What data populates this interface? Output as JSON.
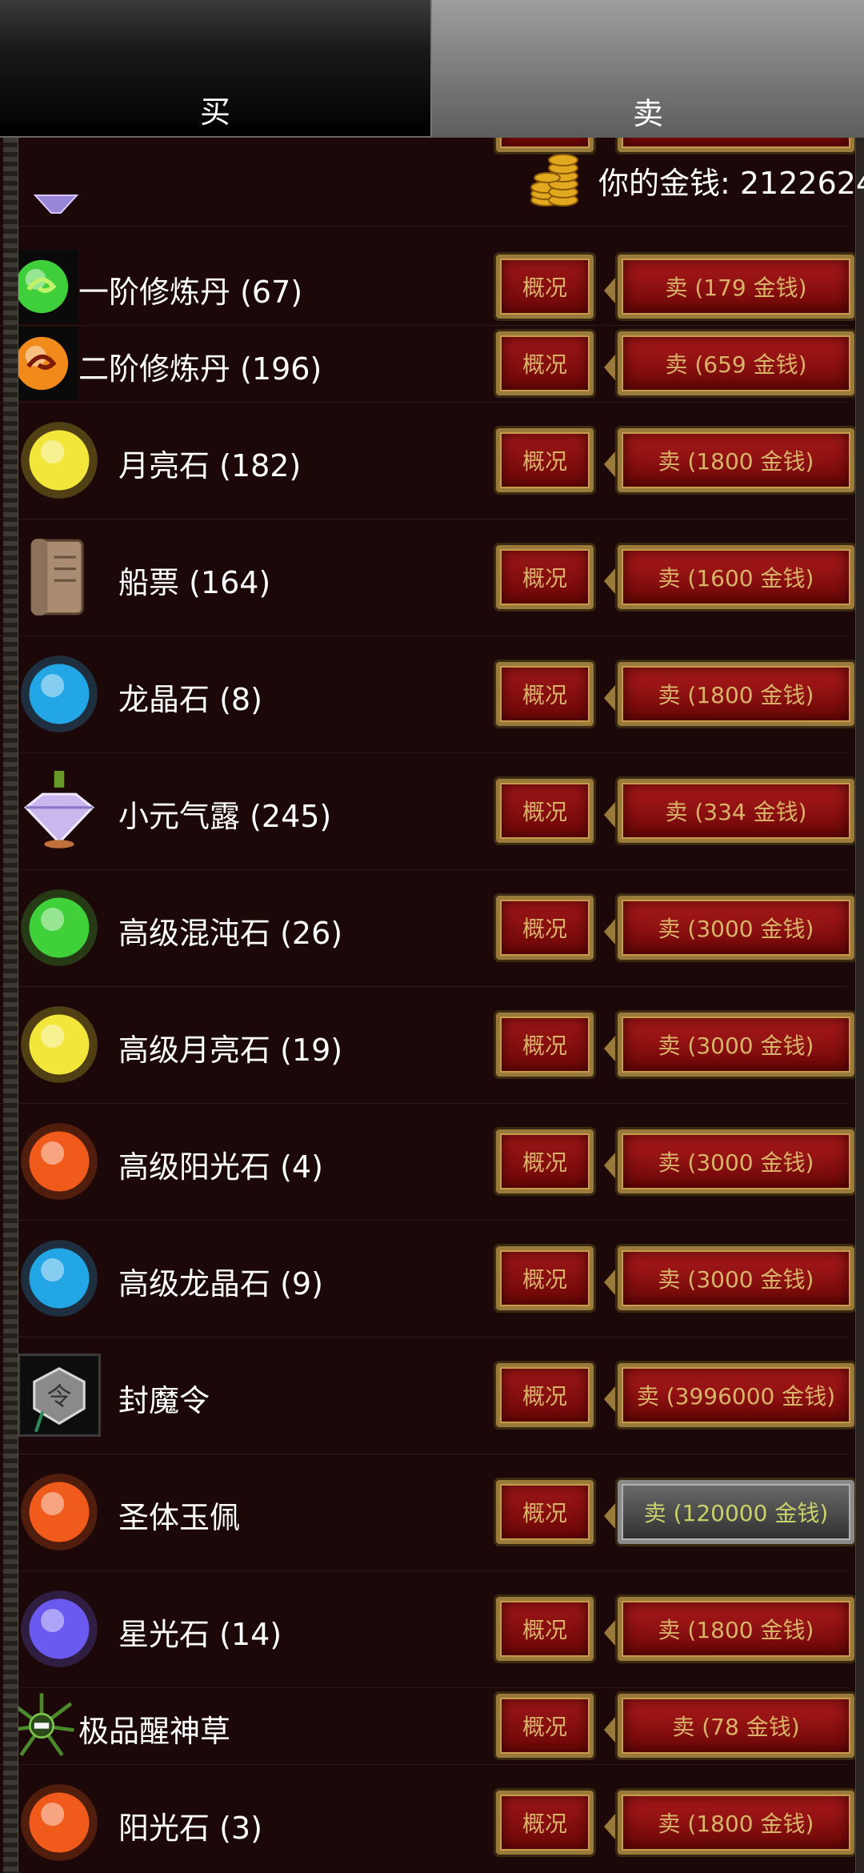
{
  "tabs": {
    "buy": "买",
    "sell": "卖"
  },
  "money": {
    "label": "你的金钱: 2122624"
  },
  "info_label": "概况",
  "items": [
    {
      "name": "一阶修炼丹 (67)",
      "price": "卖 (179 金钱)",
      "icon": "green-pill-icon",
      "color": "#3ecf3a",
      "disabled": false
    },
    {
      "name": "二阶修炼丹 (196)",
      "price": "卖 (659 金钱)",
      "icon": "orange-pill-icon",
      "color": "#f08a1a",
      "disabled": false
    },
    {
      "name": "月亮石 (182)",
      "price": "卖 (1800 金钱)",
      "icon": "moonstone-icon",
      "color": "#f2e63a",
      "disabled": false
    },
    {
      "name": "船票 (164)",
      "price": "卖 (1600 金钱)",
      "icon": "scroll-ticket-icon",
      "color": "#a98c72",
      "disabled": false
    },
    {
      "name": "龙晶石 (8)",
      "price": "卖 (1800 金钱)",
      "icon": "dragon-crystal-icon",
      "color": "#22a6e6",
      "disabled": false
    },
    {
      "name": "小元气露 (245)",
      "price": "卖 (334 金钱)",
      "icon": "diamond-potion-icon",
      "color": "#c9b7ee",
      "disabled": false
    },
    {
      "name": "高级混沌石 (26)",
      "price": "卖 (3000 金钱)",
      "icon": "chaos-stone-icon",
      "color": "#3fd03a",
      "disabled": false
    },
    {
      "name": "高级月亮石 (19)",
      "price": "卖 (3000 金钱)",
      "icon": "moonstone-icon",
      "color": "#f2e63a",
      "disabled": false
    },
    {
      "name": "高级阳光石 (4)",
      "price": "卖 (3000 金钱)",
      "icon": "sunstone-icon",
      "color": "#f05a1a",
      "disabled": false
    },
    {
      "name": "高级龙晶石 (9)",
      "price": "卖 (3000 金钱)",
      "icon": "dragon-crystal-icon",
      "color": "#22a6e6",
      "disabled": false
    },
    {
      "name": "封魔令",
      "price": "卖 (3996000 金钱)",
      "icon": "seal-token-icon",
      "color": "#9a9a9a",
      "disabled": false
    },
    {
      "name": "圣体玉佩",
      "price": "卖 (120000 金钱)",
      "icon": "jade-pendant-icon",
      "color": "#f05a1a",
      "disabled": true
    },
    {
      "name": "星光石 (14)",
      "price": "卖 (1800 金钱)",
      "icon": "starlight-stone-icon",
      "color": "#6a5af0",
      "disabled": false
    },
    {
      "name": "极品醒神草",
      "price": "卖 (78 金钱)",
      "icon": "herb-icon",
      "color": "#4b8a2a",
      "disabled": false
    },
    {
      "name": "阳光石 (3)",
      "price": "卖 (1800 金钱)",
      "icon": "sunstone-icon",
      "color": "#f05a1a",
      "disabled": false
    }
  ]
}
